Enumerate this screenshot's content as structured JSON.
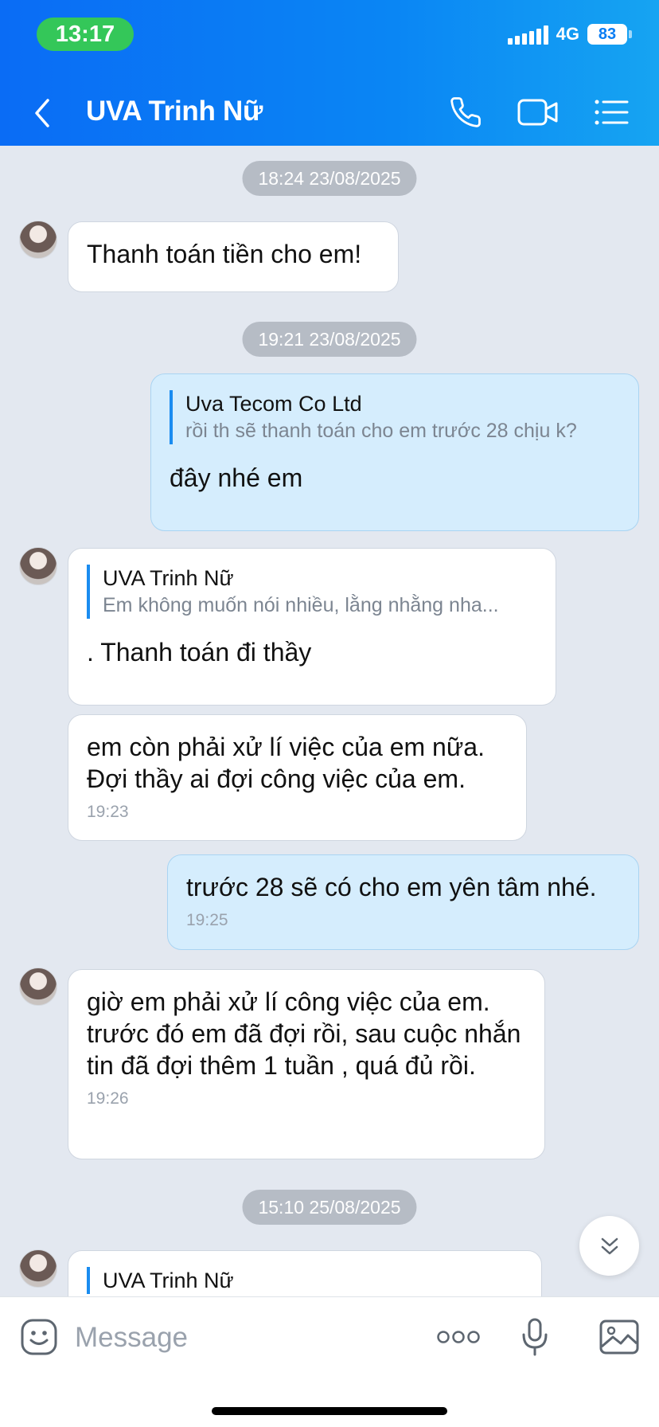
{
  "status_bar": {
    "time": "13:17",
    "network": "4G",
    "battery": "83"
  },
  "header": {
    "title": "UVA Trinh Nữ",
    "back_icon": "chevron-left-icon",
    "call_icon": "phone-icon",
    "video_icon": "video-camera-icon",
    "menu_icon": "list-menu-icon"
  },
  "messages": {
    "divider1": "18:24 23/08/2025",
    "m1": {
      "text": "Thanh toán tiền cho em!"
    },
    "divider2": "19:21 23/08/2025",
    "m2": {
      "quote_name": "Uva Tecom Co Ltd",
      "quote_text": "rồi th sẽ thanh toán cho em trước 28 chịu k?",
      "text": "đây nhé em"
    },
    "m3": {
      "quote_name": "UVA Trinh Nữ",
      "quote_text": "Em không muốn nói nhiều, lằng nhằng nha...",
      "text": ". Thanh toán đi thầy"
    },
    "m4": {
      "text": "em còn phải xử lí việc của em nữa. Đợi thầy ai đợi công việc của em.",
      "time": "19:23"
    },
    "m5": {
      "text": "trước 28 sẽ có cho em yên tâm nhé.",
      "time": "19:25"
    },
    "m6": {
      "text": "giờ em phải xử lí công việc của em. trước đó em đã đợi rồi, sau cuộc nhắn tin đã đợi thêm 1 tuần , quá đủ rồi.",
      "time": "19:26"
    },
    "divider3": "15:10 25/08/2025",
    "m7": {
      "quote_name": "UVA Trinh Nữ"
    }
  },
  "input_bar": {
    "placeholder": "Message",
    "sticker_icon": "sticker-icon",
    "more_icon": "more-dots-icon",
    "mic_icon": "microphone-icon",
    "image_icon": "image-icon"
  },
  "colors": {
    "header_start": "#0a6cf5",
    "header_end": "#16a4f2",
    "outgoing_bubble": "#d5edfd",
    "chat_background": "#e3e8f0",
    "quote_bar": "#1a8cf0"
  }
}
